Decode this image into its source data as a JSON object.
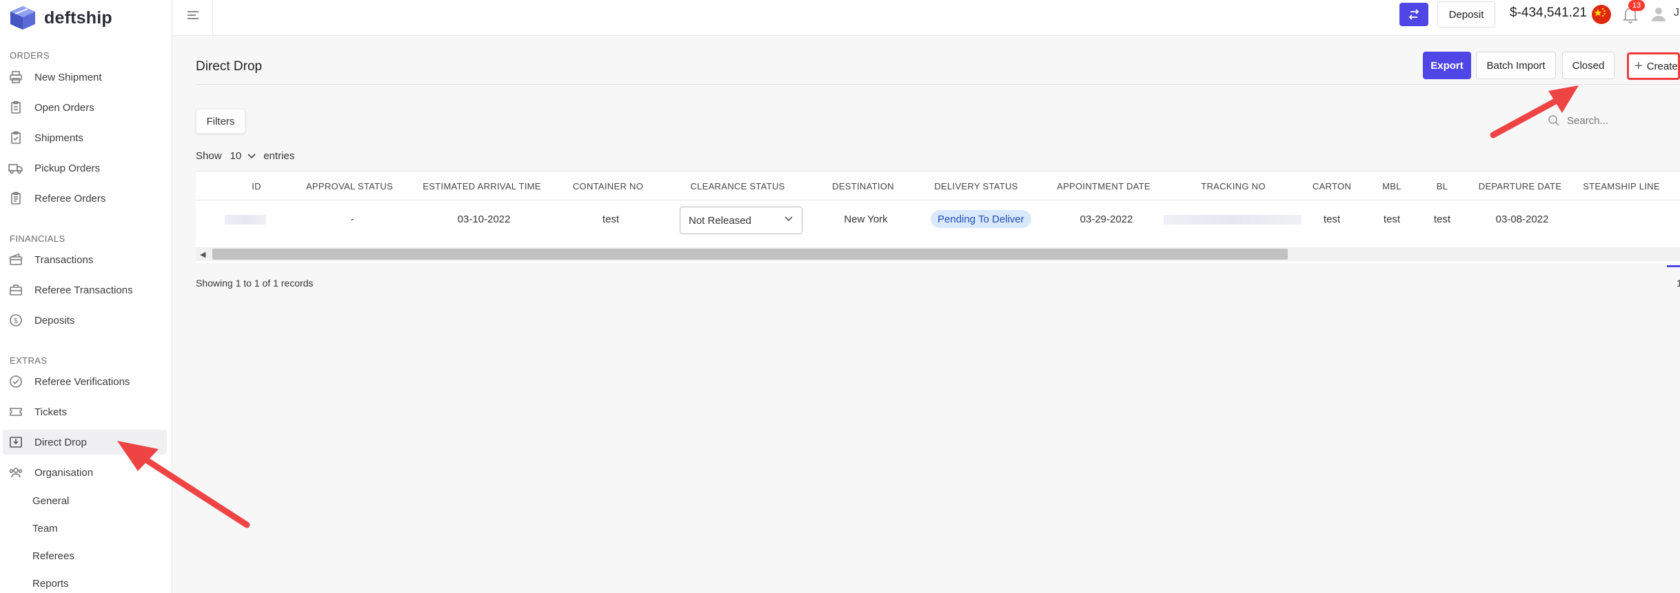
{
  "brand": {
    "name": "deftship"
  },
  "sidebar": {
    "sections": [
      {
        "label": "ORDERS"
      },
      {
        "label": "FINANCIALS"
      },
      {
        "label": "EXTRAS"
      }
    ],
    "items": [
      {
        "label": "New Shipment",
        "icon": "printer-icon"
      },
      {
        "label": "Open Orders",
        "icon": "clipboard-icon"
      },
      {
        "label": "Shipments",
        "icon": "clipboard-check-icon"
      },
      {
        "label": "Pickup Orders",
        "icon": "truck-icon"
      },
      {
        "label": "Referee Orders",
        "icon": "clipboard-list-icon"
      },
      {
        "label": "Transactions",
        "icon": "wallet-icon"
      },
      {
        "label": "Referee Transactions",
        "icon": "briefcase-icon"
      },
      {
        "label": "Deposits",
        "icon": "dollar-circle-icon"
      },
      {
        "label": "Referee Verifications",
        "icon": "check-circle-icon"
      },
      {
        "label": "Tickets",
        "icon": "ticket-icon"
      },
      {
        "label": "Direct Drop",
        "icon": "download-box-icon",
        "active": true
      },
      {
        "label": "Organisation",
        "icon": "users-icon"
      }
    ],
    "sub_items": [
      {
        "label": "General"
      },
      {
        "label": "Team"
      },
      {
        "label": "Referees"
      },
      {
        "label": "Reports"
      }
    ]
  },
  "topbar": {
    "deposit_label": "Deposit",
    "balance": "$-434,541.21",
    "notification_count": "13",
    "user_initial": "J",
    "accent": "#4f46e5"
  },
  "page": {
    "title": "Direct Drop",
    "buttons": {
      "export": "Export",
      "batch_import": "Batch Import",
      "closed": "Closed",
      "create": "Create"
    },
    "filters_label": "Filters",
    "show_label": "Show",
    "entries_value": "10",
    "entries_label": "entries",
    "search_placeholder": "Search..."
  },
  "table": {
    "columns": [
      "ID",
      "APPROVAL STATUS",
      "ESTIMATED ARRIVAL TIME",
      "CONTAINER NO",
      "CLEARANCE STATUS",
      "DESTINATION",
      "DELIVERY STATUS",
      "APPOINTMENT DATE",
      "TRACKING NO",
      "CARTON",
      "MBL",
      "BL",
      "DEPARTURE DATE",
      "STEAMSHIP LINE"
    ],
    "rows": [
      {
        "approval_status": "-",
        "estimated_arrival_time": "03-10-2022",
        "container_no": "test",
        "clearance_status": "Not Released",
        "destination": "New York",
        "delivery_status": "Pending To Deliver",
        "appointment_date": "03-29-2022",
        "carton": "test",
        "mbl": "test",
        "bl": "test",
        "departure_date": "03-08-2022"
      }
    ],
    "showing_text": "Showing 1 to 1 of 1 records",
    "current_page": "1"
  }
}
